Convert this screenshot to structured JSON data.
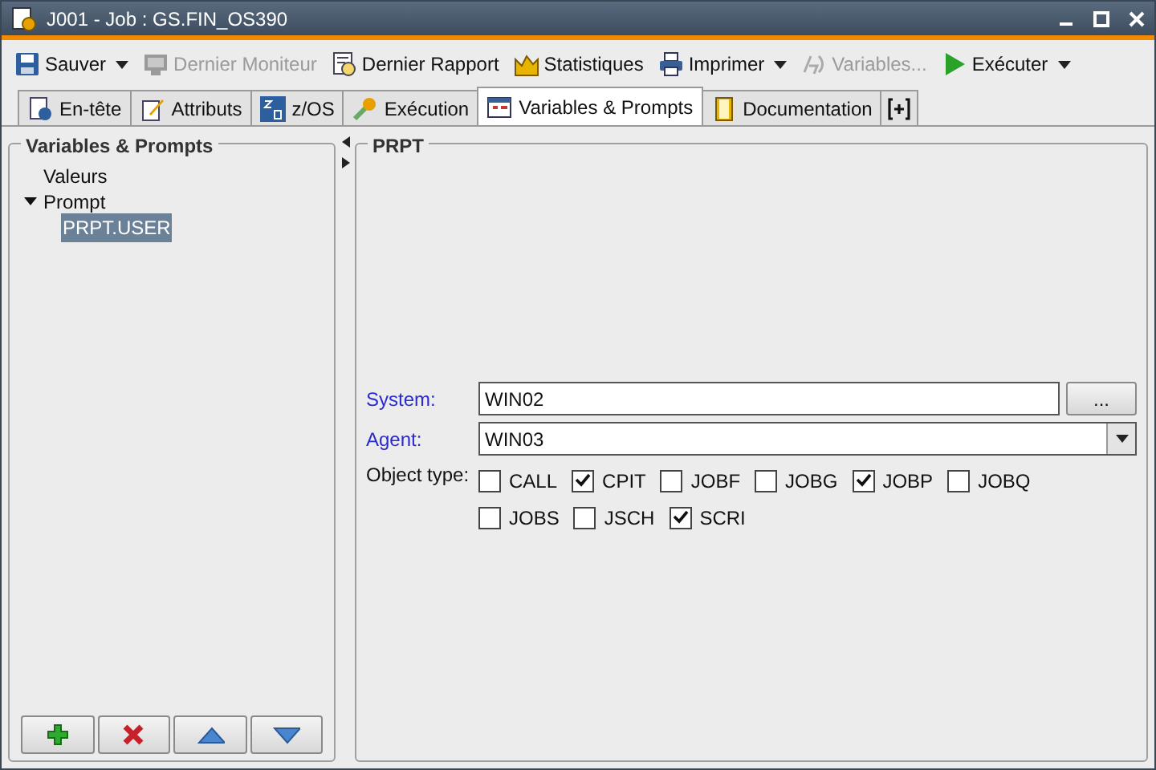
{
  "window": {
    "title": "J001 - Job : GS.FIN_OS390"
  },
  "toolbar": [
    {
      "label": "Sauver",
      "disabled": false,
      "dropdown": true
    },
    {
      "label": "Dernier Moniteur",
      "disabled": true,
      "dropdown": false
    },
    {
      "label": "Dernier Rapport",
      "disabled": false,
      "dropdown": false
    },
    {
      "label": "Statistiques",
      "disabled": false,
      "dropdown": false
    },
    {
      "label": "Imprimer",
      "disabled": false,
      "dropdown": true
    },
    {
      "label": "Variables...",
      "disabled": true,
      "dropdown": false
    },
    {
      "label": "Exécuter",
      "disabled": false,
      "dropdown": true
    }
  ],
  "tabs": [
    {
      "label": "En-tête",
      "selected": false
    },
    {
      "label": "Attributs",
      "selected": false
    },
    {
      "label": "z/OS",
      "selected": false
    },
    {
      "label": "Exécution",
      "selected": false
    },
    {
      "label": "Variables & Prompts",
      "selected": true
    },
    {
      "label": "Documentation",
      "selected": false
    }
  ],
  "left_panel": {
    "title": "Variables & Prompts",
    "tree": [
      {
        "label": "Valeurs",
        "selected": false
      },
      {
        "label": "Prompt",
        "expanded": true,
        "selected": false,
        "children": [
          {
            "label": "PRPT.USER",
            "selected": true
          }
        ]
      }
    ]
  },
  "right_panel": {
    "title": "PRPT",
    "system": {
      "label": "System:",
      "value": "WIN02",
      "button": "..."
    },
    "agent": {
      "label": "Agent:",
      "value": "WIN03"
    },
    "object_type": {
      "label": "Object type:",
      "options": [
        {
          "label": "CALL",
          "checked": false
        },
        {
          "label": "CPIT",
          "checked": true
        },
        {
          "label": "JOBF",
          "checked": false
        },
        {
          "label": "JOBG",
          "checked": false
        },
        {
          "label": "JOBP",
          "checked": true
        },
        {
          "label": "JOBQ",
          "checked": false
        },
        {
          "label": "JOBS",
          "checked": false
        },
        {
          "label": "JSCH",
          "checked": false
        },
        {
          "label": "SCRI",
          "checked": true
        }
      ]
    }
  }
}
